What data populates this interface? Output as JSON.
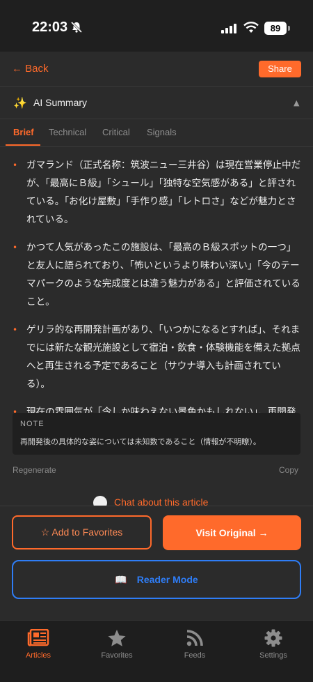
{
  "status": {
    "time": "22:03",
    "battery": "89"
  },
  "header": {
    "back_label": "← Back",
    "share_label": "Share"
  },
  "summary": {
    "title": "AI Summary",
    "collapse_icon": "chevron-up-icon"
  },
  "tabs": [
    {
      "label": "Brief",
      "active": true
    },
    {
      "label": "Technical",
      "active": false
    },
    {
      "label": "Critical",
      "active": false
    },
    {
      "label": "Signals",
      "active": false
    }
  ],
  "bullets": [
    "ガマランド（正式名称：筑波ニュー三井谷）は現在営業停止中だが、「最高にＢ級」「シュール」「独特な空気感がある」と評されている。「お化け屋敷」「手作り感」「レトロさ」などが魅力とされている。",
    "かつて人気があったこの施設は、「最高のＢ級スポットの一つ」と友人に語られており、「怖いというより味わい深い」「今のテーマパークのような完成度とは違う魅力がある」と評価されていること。",
    "ゲリラ的な再開発計画があり、「いつかになるとすれば」、それまでには新たな観光施設として宿泊・飲食・体験機能を備えた拠点へと再生される予定であること（サウナ導入も計画されている）。",
    "現在の雰囲気が「今しか味わえない景色かもしれない」。再開発されればきれいになる可能性がある一方、「なんとも言えない空気感」を残すことが重要である。"
  ],
  "note": {
    "title": "NOTE",
    "text": "再開発後の具体的な姿については未知数であること（情報が不明瞭）。"
  },
  "summary_actions": {
    "regenerate": "Regenerate",
    "copy": "Copy"
  },
  "chat": {
    "label": "Chat about this article"
  },
  "actions": {
    "favorites": "☆ Add to Favorites",
    "visit": "Visit Original →",
    "reader": "Reader Mode"
  },
  "tabbar": [
    {
      "label": "Articles",
      "icon": "newspaper-icon",
      "active": true
    },
    {
      "label": "Favorites",
      "icon": "star-icon",
      "active": false
    },
    {
      "label": "Feeds",
      "icon": "rss-icon",
      "active": false
    },
    {
      "label": "Settings",
      "icon": "gear-icon",
      "active": false
    }
  ],
  "colors": {
    "accent": "#ff6a2b",
    "reader": "#2f7df6",
    "background": "#2b2b2b"
  }
}
